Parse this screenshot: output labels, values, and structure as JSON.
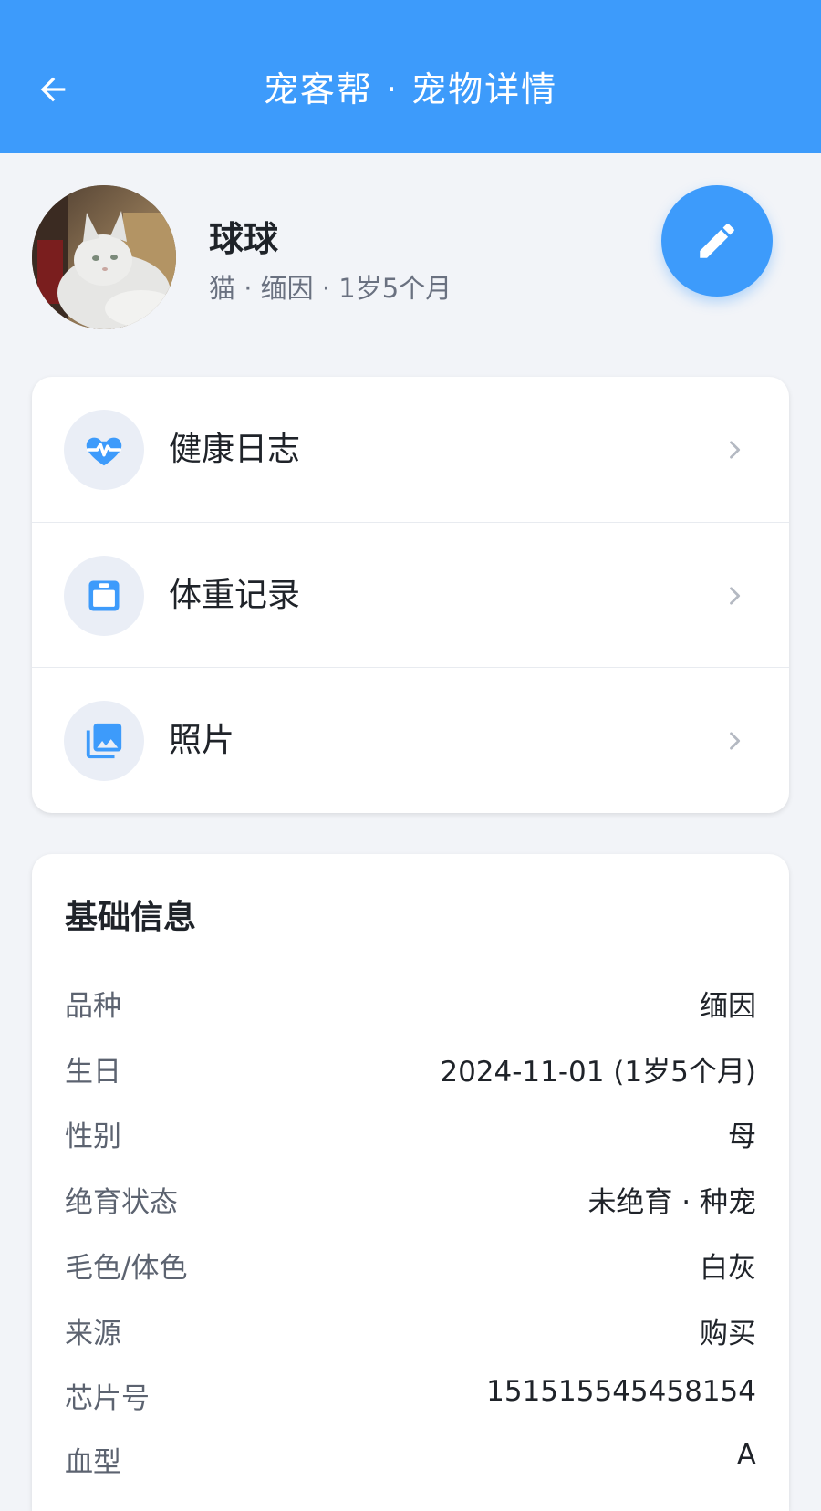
{
  "appbar": {
    "title": "宠客帮 · 宠物详情",
    "back_icon": "arrow-left-icon"
  },
  "colors": {
    "primary": "#3d9bfb",
    "background": "#f2f4f8",
    "text": "#1f2329",
    "muted": "#6a7180"
  },
  "pet": {
    "name": "球球",
    "subtitle": "猫 · 缅因 · 1岁5个月",
    "avatar_icon": "cat-photo"
  },
  "edit": {
    "icon": "pencil-icon"
  },
  "menu": [
    {
      "label": "健康日志",
      "icon": "heartbeat-icon"
    },
    {
      "label": "体重记录",
      "icon": "scale-icon"
    },
    {
      "label": "照片",
      "icon": "photo-icon"
    }
  ],
  "basic_info": {
    "title": "基础信息",
    "rows": [
      {
        "label": "品种",
        "value": "缅因"
      },
      {
        "label": "生日",
        "value": "2024-11-01 (1岁5个月)"
      },
      {
        "label": "性别",
        "value": "母"
      },
      {
        "label": "绝育状态",
        "value": "未绝育 · 种宠"
      },
      {
        "label": "毛色/体色",
        "value": "白灰"
      },
      {
        "label": "来源",
        "value": "购买"
      },
      {
        "label": "芯片号",
        "value": "151515545458154"
      },
      {
        "label": "血型",
        "value": "A"
      }
    ]
  }
}
